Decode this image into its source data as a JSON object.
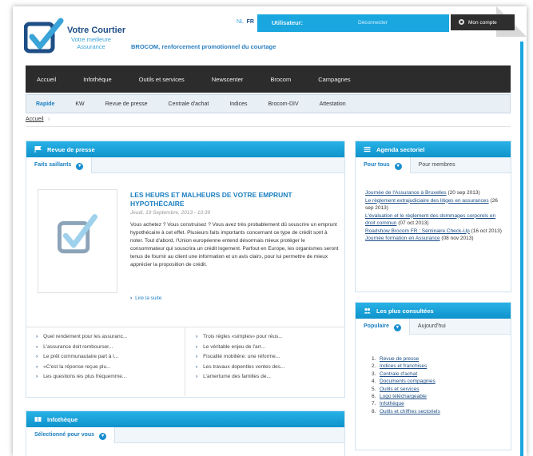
{
  "header": {
    "brand_title": "Votre Courtier",
    "brand_sub": "Votre meilleure Assurance",
    "tagline": "BROCOM, renforcement promotionnel du courtage",
    "lang_nl": "NL",
    "lang_fr": "FR",
    "user_label": "Utilisateur:",
    "logout": "Déconnecter",
    "account": "Mon compte"
  },
  "main_nav": [
    "Accueil",
    "Infothèque",
    "Outils et services",
    "Newscenter",
    "Brocom",
    "Campagnes"
  ],
  "sub_nav": [
    "Rapide",
    "KW",
    "Revue de presse",
    "Centrale d'achat",
    "Indices",
    "Brocom-DIV",
    "Attestation"
  ],
  "breadcrumb": "Accueil",
  "revue": {
    "title": "Revue de presse",
    "tab": "Faits saillants",
    "article_title": "LES HEURS ET MALHEURS DE VOTRE EMPRUNT HYPOTHÉCAIRE",
    "article_date": "Jeudi, 19 Septembre, 2013 - 10:39",
    "article_body": "Vous achetez ? Vous construisez ? Vous avez très probablement dû souscrire un emprunt hypothécaire à cet effet. Plusieurs faits importants concernant ce type de crédit sont à noter. Tout d'abord, l'Union européenne entend désormais mieux protéger le consommateur qui souscrira un crédit logement. Parfout en Europe, les organismes seront tenus de fournir au client une information et un avis clairs, pour lui permettre de mieux apprécier la proposition de crédit.",
    "read_more": "Lire la suite",
    "links_left": [
      "Quel rendement pour les assuranc...",
      "L'assurance doit rembourser...",
      "Le prêt communautaire part à l...",
      "«C'est la réponse reçue plu...",
      "Les questions les plus fréquemme..."
    ],
    "links_right": [
      "Trois règles «simples» pour réus...",
      "Le véritable enjeu de l'arr...",
      "Fiscalité mobilière: une réforme...",
      "Les travaux dopentles ventes des...",
      "L'amertume des familles de..."
    ]
  },
  "infotheque": {
    "title": "Infothèque",
    "tab": "Sélectionné pour vous"
  },
  "agenda": {
    "title": "Agenda sectoriel",
    "tab_active": "Pour tous",
    "tab_other": "Pour membres",
    "items": [
      {
        "link": "Journée de l'Assurance à Bruxelles",
        "date": "(20 sep 2013)"
      },
      {
        "link": "Le règlement extrajudiciaire des litiges en assurances",
        "date": "(26 sep 2013)"
      },
      {
        "link": "L'évaluation et le règlement des dommages corporels en droit commun",
        "date": "(07 oct 2013)"
      },
      {
        "link": "Roadshow Brocom FR : Séminaire Check-Up",
        "date": "(16 oct 2013)"
      },
      {
        "link": "Journée formation en Assurance",
        "date": "(08 nov 2013)"
      }
    ]
  },
  "consultees": {
    "title": "Les plus consultées",
    "tab_active": "Populaire",
    "tab_other": "Aujourd'hui",
    "items": [
      "Revue de presse",
      "Indices et franchises",
      "Centrale d'achat",
      "Documents compagnies",
      "Outils et services",
      "Logo téléchargeable",
      "Infothèque",
      "Outils et chiffres sectoriels"
    ]
  },
  "colors": {
    "accent": "#1aa7df",
    "nav_dark": "#2c2c2c",
    "link": "#1d4e86"
  }
}
